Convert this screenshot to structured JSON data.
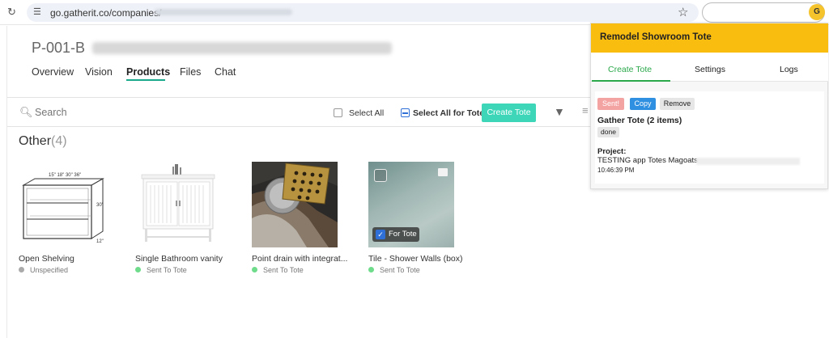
{
  "browser": {
    "url": "go.gatherit.co/companies/",
    "reload_icon": "reload-icon",
    "star_icon": "star-icon",
    "extension_icon": "gatherit-extension-icon"
  },
  "project": {
    "code": "P-001-B",
    "tabs": [
      "Overview",
      "Vision",
      "Products",
      "Files",
      "Chat"
    ],
    "active_tab": "Products"
  },
  "toolbar": {
    "search_placeholder": "Search",
    "select_all": "Select All",
    "select_all_tote": "Select All for Tote",
    "create_tote": "Create Tote"
  },
  "section": {
    "title": "Other",
    "count": "(4)"
  },
  "products": [
    {
      "title": "Open Shelving",
      "status": "Unspecified",
      "status_color": "#aaaaaa"
    },
    {
      "title": "Single Bathroom vanity",
      "status": "Sent To Tote",
      "status_color": "#6fdc8c"
    },
    {
      "title": "Point drain with integrat...",
      "status": "Sent To Tote",
      "status_color": "#6fdc8c"
    },
    {
      "title": "Tile - Shower Walls (box)",
      "status": "Sent To Tote",
      "status_color": "#6fdc8c",
      "badge": "For Tote"
    }
  ],
  "shelf_dims": "15\" 18\" 30\" 36\"",
  "shelf_height": "30\"",
  "shelf_depth": "12\"",
  "panel": {
    "title": "Remodel Showroom Tote",
    "tabs": [
      "Create Tote",
      "Settings",
      "Logs"
    ],
    "buttons": {
      "sent": "Sent!",
      "copy": "Copy",
      "remove": "Remove"
    },
    "gather": "Gather Tote (2 items)",
    "done": "done",
    "project_label": "Project:",
    "project_value": "TESTING app Totes Magoats",
    "time": "10:46:39 PM"
  },
  "colors": {
    "accent_teal": "#3dd6b8",
    "panel_yellow": "#f9bd10",
    "panel_green": "#2aa84a",
    "copy_blue": "#2f8fe0"
  }
}
